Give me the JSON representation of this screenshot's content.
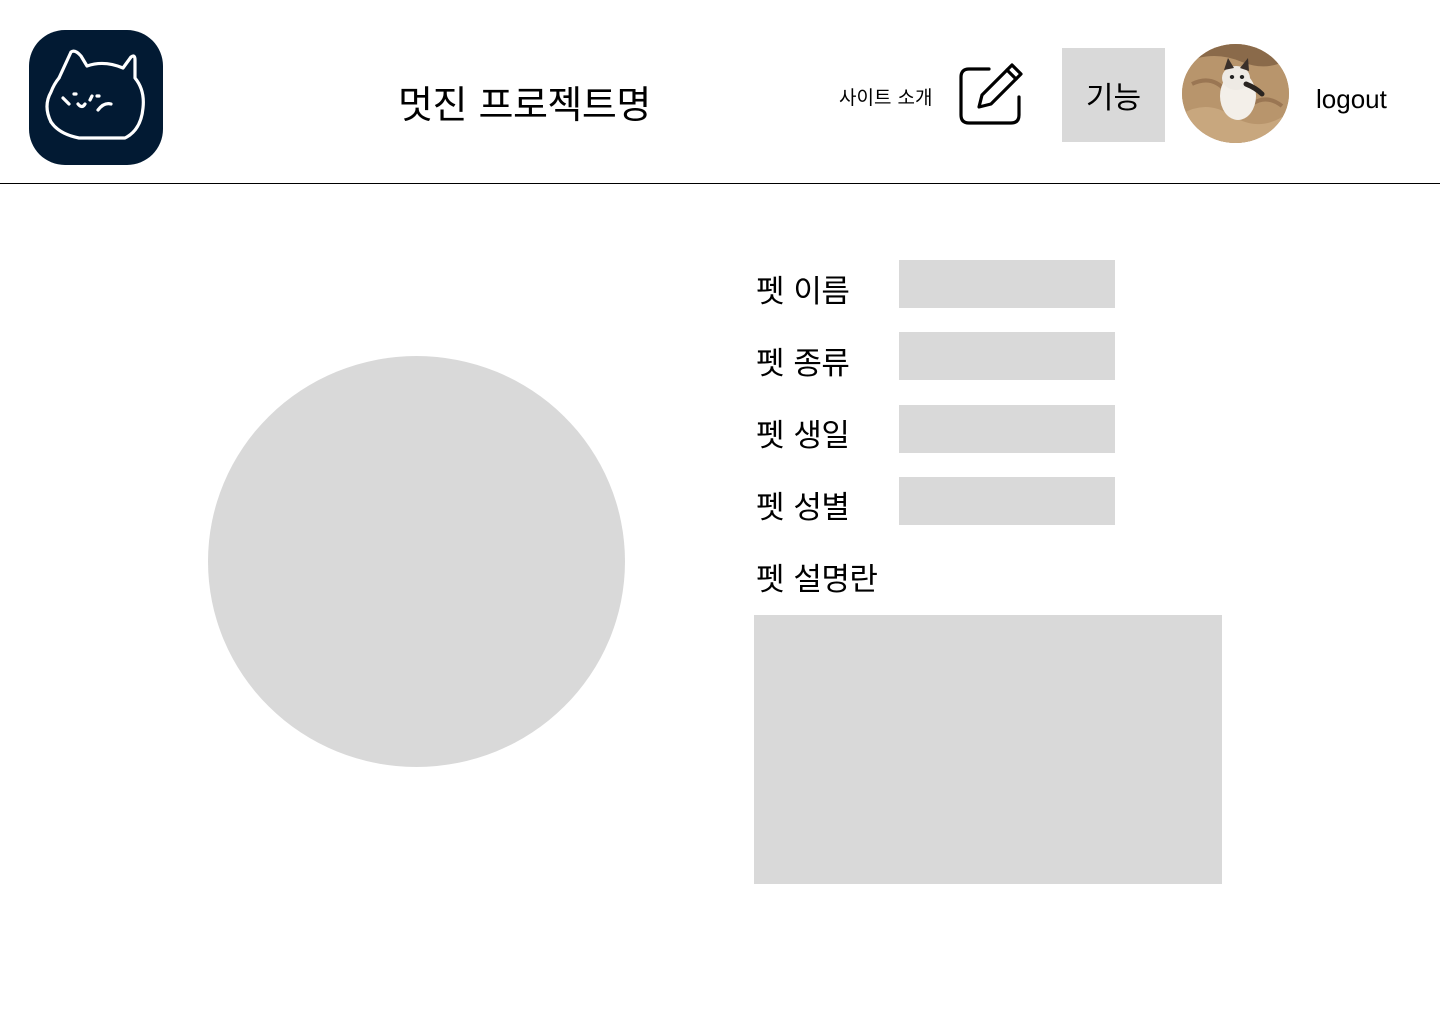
{
  "header": {
    "logo_icon": "cat-face-icon",
    "title": "멋진 프로젝트명",
    "nav_about": "사이트 소개",
    "edit_icon": "edit-pencil-icon",
    "feature_button": "기능",
    "avatar_icon": "user-avatar-photo",
    "logout": "logout"
  },
  "pet_form": {
    "photo_placeholder_icon": "pet-photo-placeholder",
    "fields": [
      {
        "label": "펫 이름",
        "value": ""
      },
      {
        "label": "펫 종류",
        "value": ""
      },
      {
        "label": "펫 생일",
        "value": ""
      },
      {
        "label": "펫 성별",
        "value": ""
      }
    ],
    "description_label": "펫 설명란",
    "description_value": ""
  },
  "colors": {
    "logo_background": "#021a33",
    "placeholder_gray": "#d9d9d9",
    "divider": "#000000"
  }
}
